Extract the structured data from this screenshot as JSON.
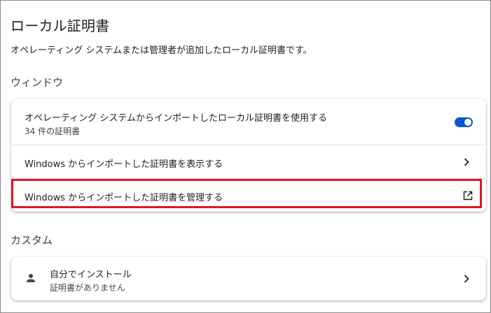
{
  "page": {
    "title": "ローカル証明書",
    "description": "オペレーティング システムまたは管理者が追加したローカル証明書です。"
  },
  "sections": {
    "window": {
      "label": "ウィンドウ",
      "rows": [
        {
          "title": "オペレーティング システムからインポートしたローカル証明書を使用する",
          "subtitle": "34 件の証明書",
          "toggle_on": true,
          "icon": "toggle-switch"
        },
        {
          "title": "Windows からインポートした証明書を表示する",
          "icon": "chevron-right-icon"
        },
        {
          "title": "Windows からインポートした証明書を管理する",
          "icon": "external-link-icon"
        }
      ]
    },
    "custom": {
      "label": "カスタム",
      "rows": [
        {
          "title": "自分でインストール",
          "subtitle": "証明書がありません",
          "icon": "person-icon",
          "trailing_icon": "chevron-right-icon"
        }
      ]
    }
  },
  "colors": {
    "accent": "#0b57d0",
    "highlight_border": "#e0171f",
    "text_primary": "#1f1f1f",
    "divider": "#e3e3e3"
  }
}
